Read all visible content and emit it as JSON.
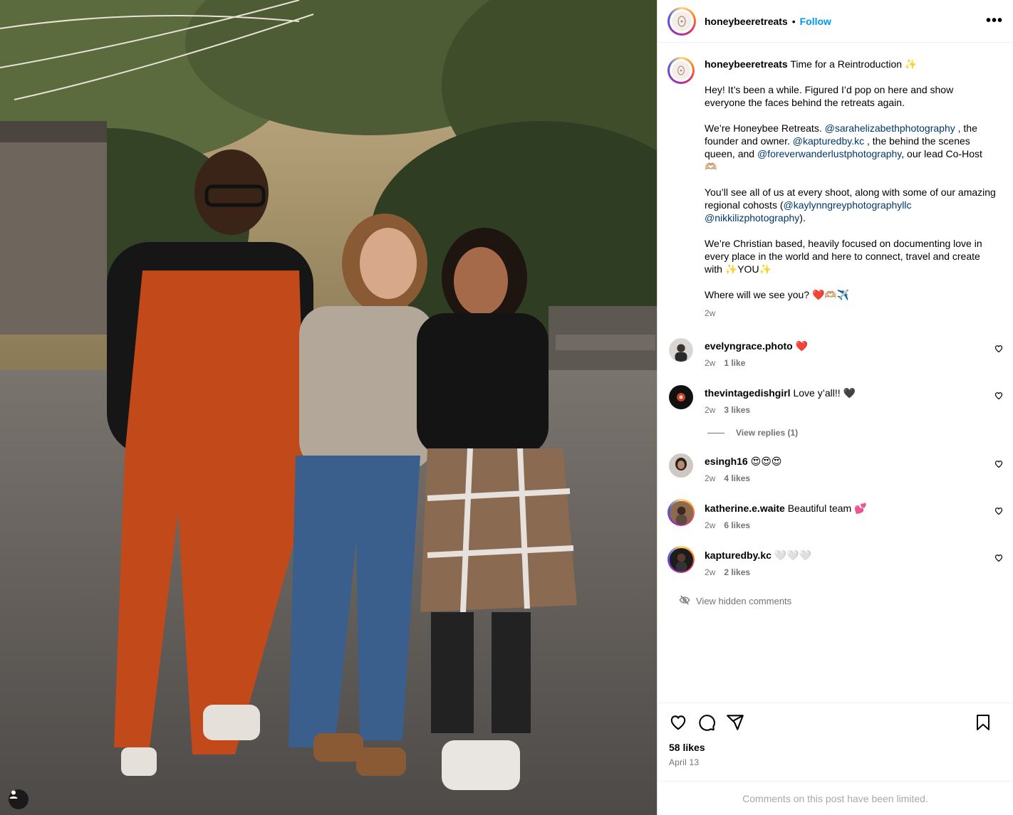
{
  "post": {
    "username": "honeybeeretreats",
    "separator": "•",
    "follow_label": "Follow",
    "more_label": "•••"
  },
  "caption": {
    "username": "honeybeeretreats",
    "title": "Time for a Reintroduction ✨",
    "p1": "Hey! It’s been a while. Figured I’d pop on here and show everyone the faces behind the retreats again.",
    "p2_a": "We’re Honeybee Retreats. ",
    "m1": "@sarahelizabethphotography",
    "p2_b": " , the founder and owner. ",
    "m2": "@kapturedby.kc",
    "p2_c": " , the behind the scenes queen, and ",
    "m3": "@foreverwanderlustphotography",
    "p2_d": ", our lead Co-Host 🫶🏼",
    "p3_a": "You’ll see all of us at every shoot, along with some of our amazing regional cohosts (",
    "m4": "@kaylynngreyphotographyllc",
    "m5": "@nikkilizphotography",
    "p3_b": ").",
    "p4": "We’re Christian based, heavily focused on documenting love in every place in the world and here to connect, travel and create with ✨YOU✨",
    "p5": "Where will we see you? ❤️🫶🏼✈️",
    "time": "2w"
  },
  "comments": [
    {
      "user": "evelyngrace.photo",
      "text": "❤️",
      "time": "2w",
      "likes": "1 like"
    },
    {
      "user": "thevintagedishgirl",
      "text": "Love y’all!! 🖤",
      "time": "2w",
      "likes": "3 likes"
    },
    {
      "user": "esingh16",
      "text": "😍😍😍",
      "time": "2w",
      "likes": "4 likes"
    },
    {
      "user": "katherine.e.waite",
      "text": "Beautiful team 💕",
      "time": "2w",
      "likes": "6 likes"
    },
    {
      "user": "kapturedby.kc",
      "text": "🤍🤍🤍",
      "time": "2w",
      "likes": "2 likes"
    }
  ],
  "view_replies": "View replies (1)",
  "view_hidden": "View hidden comments",
  "footer": {
    "likes": "58 likes",
    "date": "April 13",
    "limited": "Comments on this post have been limited."
  },
  "icons": {
    "like": "heart-icon",
    "comment": "comment-icon",
    "share": "share-icon",
    "save": "bookmark-icon",
    "tag": "user-tag-icon",
    "hidden": "eye-off-icon"
  },
  "colors": {
    "link": "#00376b",
    "follow": "#0095f6",
    "muted": "#737373"
  }
}
